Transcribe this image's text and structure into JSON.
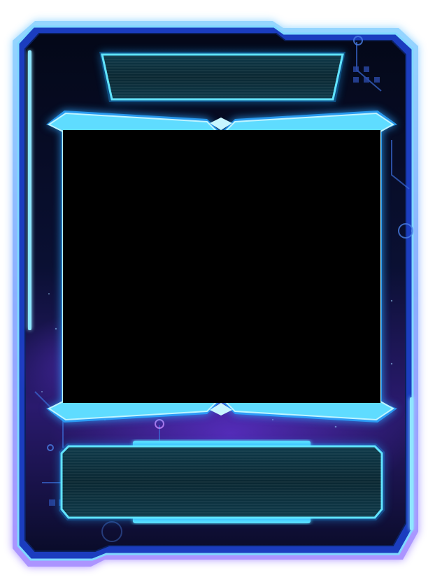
{
  "card": {
    "title_text": "",
    "description_text": "",
    "portrait_empty": true
  },
  "colors": {
    "page_background": "#ffffff",
    "frame_glow": "#2f7dff",
    "neon_cyan": "#49d6ff",
    "frame_dark": "#050a1d",
    "space_purple": "#35207a",
    "portrait": "#000000",
    "plate_teal": "#0f3b4a",
    "plate_border": "#5fe3ff"
  }
}
